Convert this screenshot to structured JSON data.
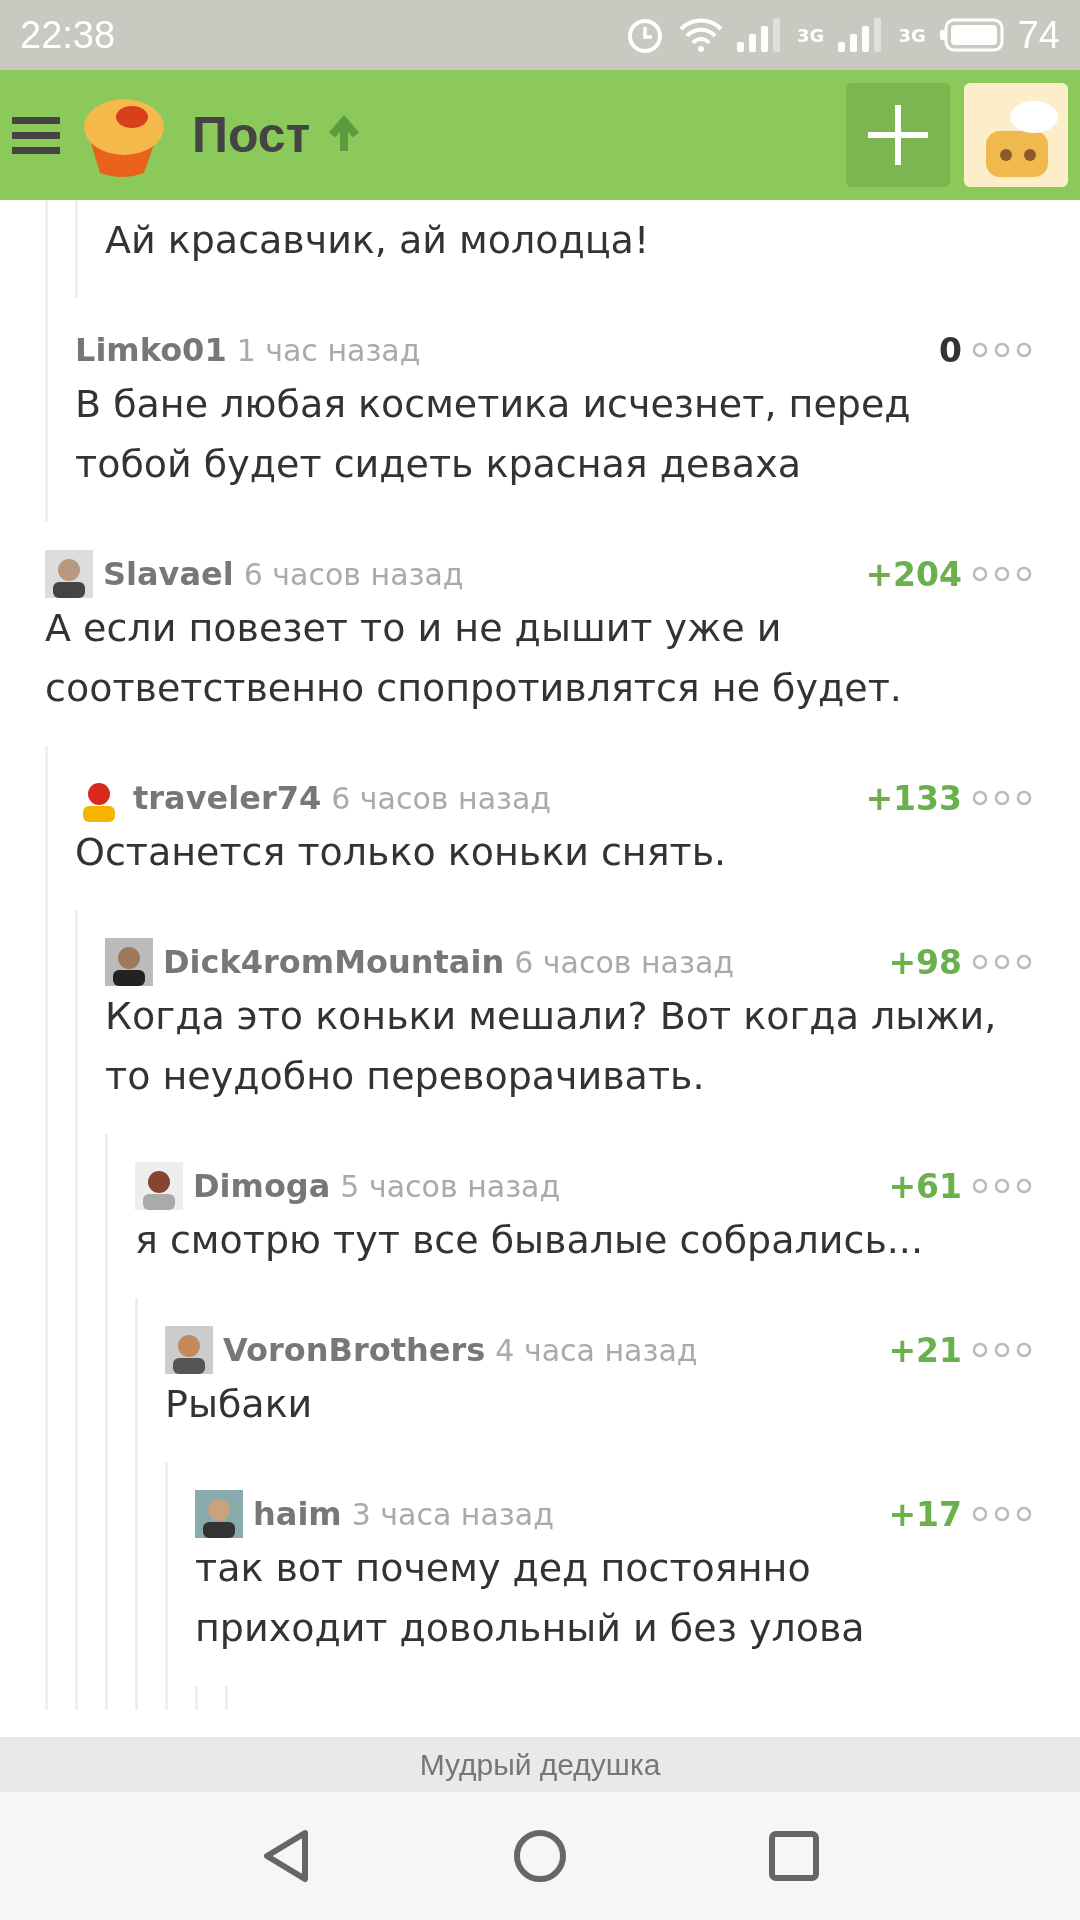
{
  "status_bar": {
    "time": "22:38",
    "network_labels": [
      "3G",
      "3G"
    ],
    "battery": "74"
  },
  "app_bar": {
    "title": "Пост"
  },
  "comments": [
    {
      "kind": "continuation",
      "children": [
        {
          "kind": "continuation",
          "children": [
            {
              "kind": "fragment",
              "text": "Ай красавчик, ай молодца!"
            }
          ]
        },
        {
          "kind": "comment",
          "author": "Limko01",
          "time": "1 час назад",
          "rating": "0",
          "rating_positive": false,
          "avatar": false,
          "text": "В бане любая косметика исчезнет, перед тобой будет сидеть красная деваха"
        }
      ]
    },
    {
      "kind": "comment",
      "author": "Slavael",
      "time": "6 часов назад",
      "rating": "+204",
      "rating_positive": true,
      "avatar": true,
      "text": "А если повезет то и не дышит уже и соответственно спопротивлятся не будет.",
      "children": [
        {
          "kind": "comment",
          "author": "traveler74",
          "time": "6 часов назад",
          "rating": "+133",
          "rating_positive": true,
          "avatar": true,
          "text": "Останется только коньки снять.",
          "children": [
            {
              "kind": "comment",
              "author": "Dick4romMountain",
              "time": "6 часов назад",
              "rating": "+98",
              "rating_positive": true,
              "avatar": true,
              "text": "Когда это коньки мешали? Вот когда лыжи, то неудобно переворачивать.",
              "children": [
                {
                  "kind": "comment",
                  "author": "Dimoga",
                  "time": "5 часов назад",
                  "rating": "+61",
                  "rating_positive": true,
                  "avatar": true,
                  "text": "я смотрю тут все бывалые собрались...",
                  "children": [
                    {
                      "kind": "comment",
                      "author": "VoronBrothers",
                      "time": "4 часа назад",
                      "rating": "+21",
                      "rating_positive": true,
                      "avatar": true,
                      "text": "Рыбаки",
                      "children": [
                        {
                          "kind": "comment",
                          "author": "haim",
                          "time": "3 часа назад",
                          "rating": "+17",
                          "rating_positive": true,
                          "avatar": true,
                          "text": "так вот почему дед постоянно приходит довольный и без улова",
                          "children": [
                            {
                              "kind": "continuation"
                            }
                          ]
                        }
                      ]
                    }
                  ]
                }
              ]
            }
          ]
        }
      ]
    }
  ],
  "toast": "Мудрый дедушка"
}
